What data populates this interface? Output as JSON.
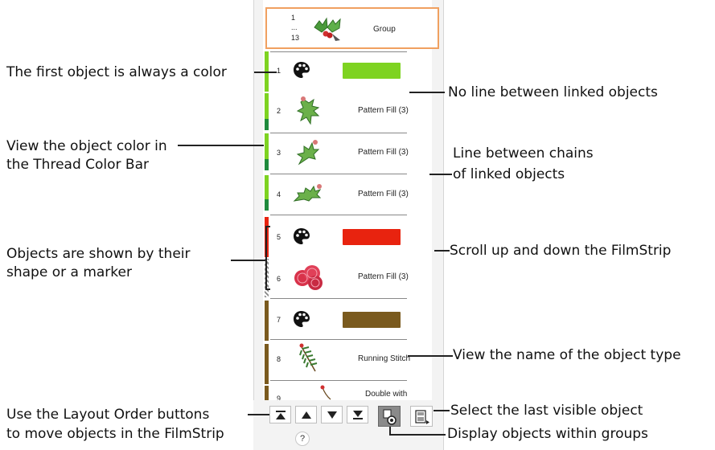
{
  "group": {
    "range_start": "1",
    "range_dots": "...",
    "range_end": "13",
    "label": "Group"
  },
  "rows": [
    {
      "num": "1",
      "label": ""
    },
    {
      "num": "2",
      "label": "Pattern Fill (3)"
    },
    {
      "num": "3",
      "label": "Pattern Fill (3)"
    },
    {
      "num": "4",
      "label": "Pattern Fill (3)"
    },
    {
      "num": "5",
      "label": ""
    },
    {
      "num": "6",
      "label": "Pattern Fill (3)"
    },
    {
      "num": "7",
      "label": ""
    },
    {
      "num": "8",
      "label": "Running Stitch"
    },
    {
      "num": "9",
      "label": "Double with"
    }
  ],
  "help_label": "?",
  "callouts": {
    "first_object": "The first object is always a color",
    "view_color_1": "View the object color in",
    "view_color_2": "the Thread Color Bar",
    "objects_shown_1": "Objects are shown by their",
    "objects_shown_2": "shape or a marker",
    "layout_order_1": "Use the Layout Order buttons",
    "layout_order_2": "to move objects in the FilmStrip",
    "no_line": "No line between linked objects",
    "line_between_1": "Line between chains",
    "line_between_2": "of linked objects",
    "scroll": "Scroll up and down the FilmStrip",
    "view_name": "View the name of the object type",
    "select_last": "Select the last visible object",
    "display_groups": "Display objects within groups"
  },
  "colors": {
    "green_light": "#7ed321",
    "green_dark": "#1e8a3c",
    "red": "#e8230f",
    "brown": "#7a5a1e",
    "group_border": "#f0a060"
  },
  "icons": {
    "palette": "palette-icon",
    "holly": "holly-leaf-icon",
    "berries": "berries-icon",
    "stitch": "running-stitch-icon"
  }
}
